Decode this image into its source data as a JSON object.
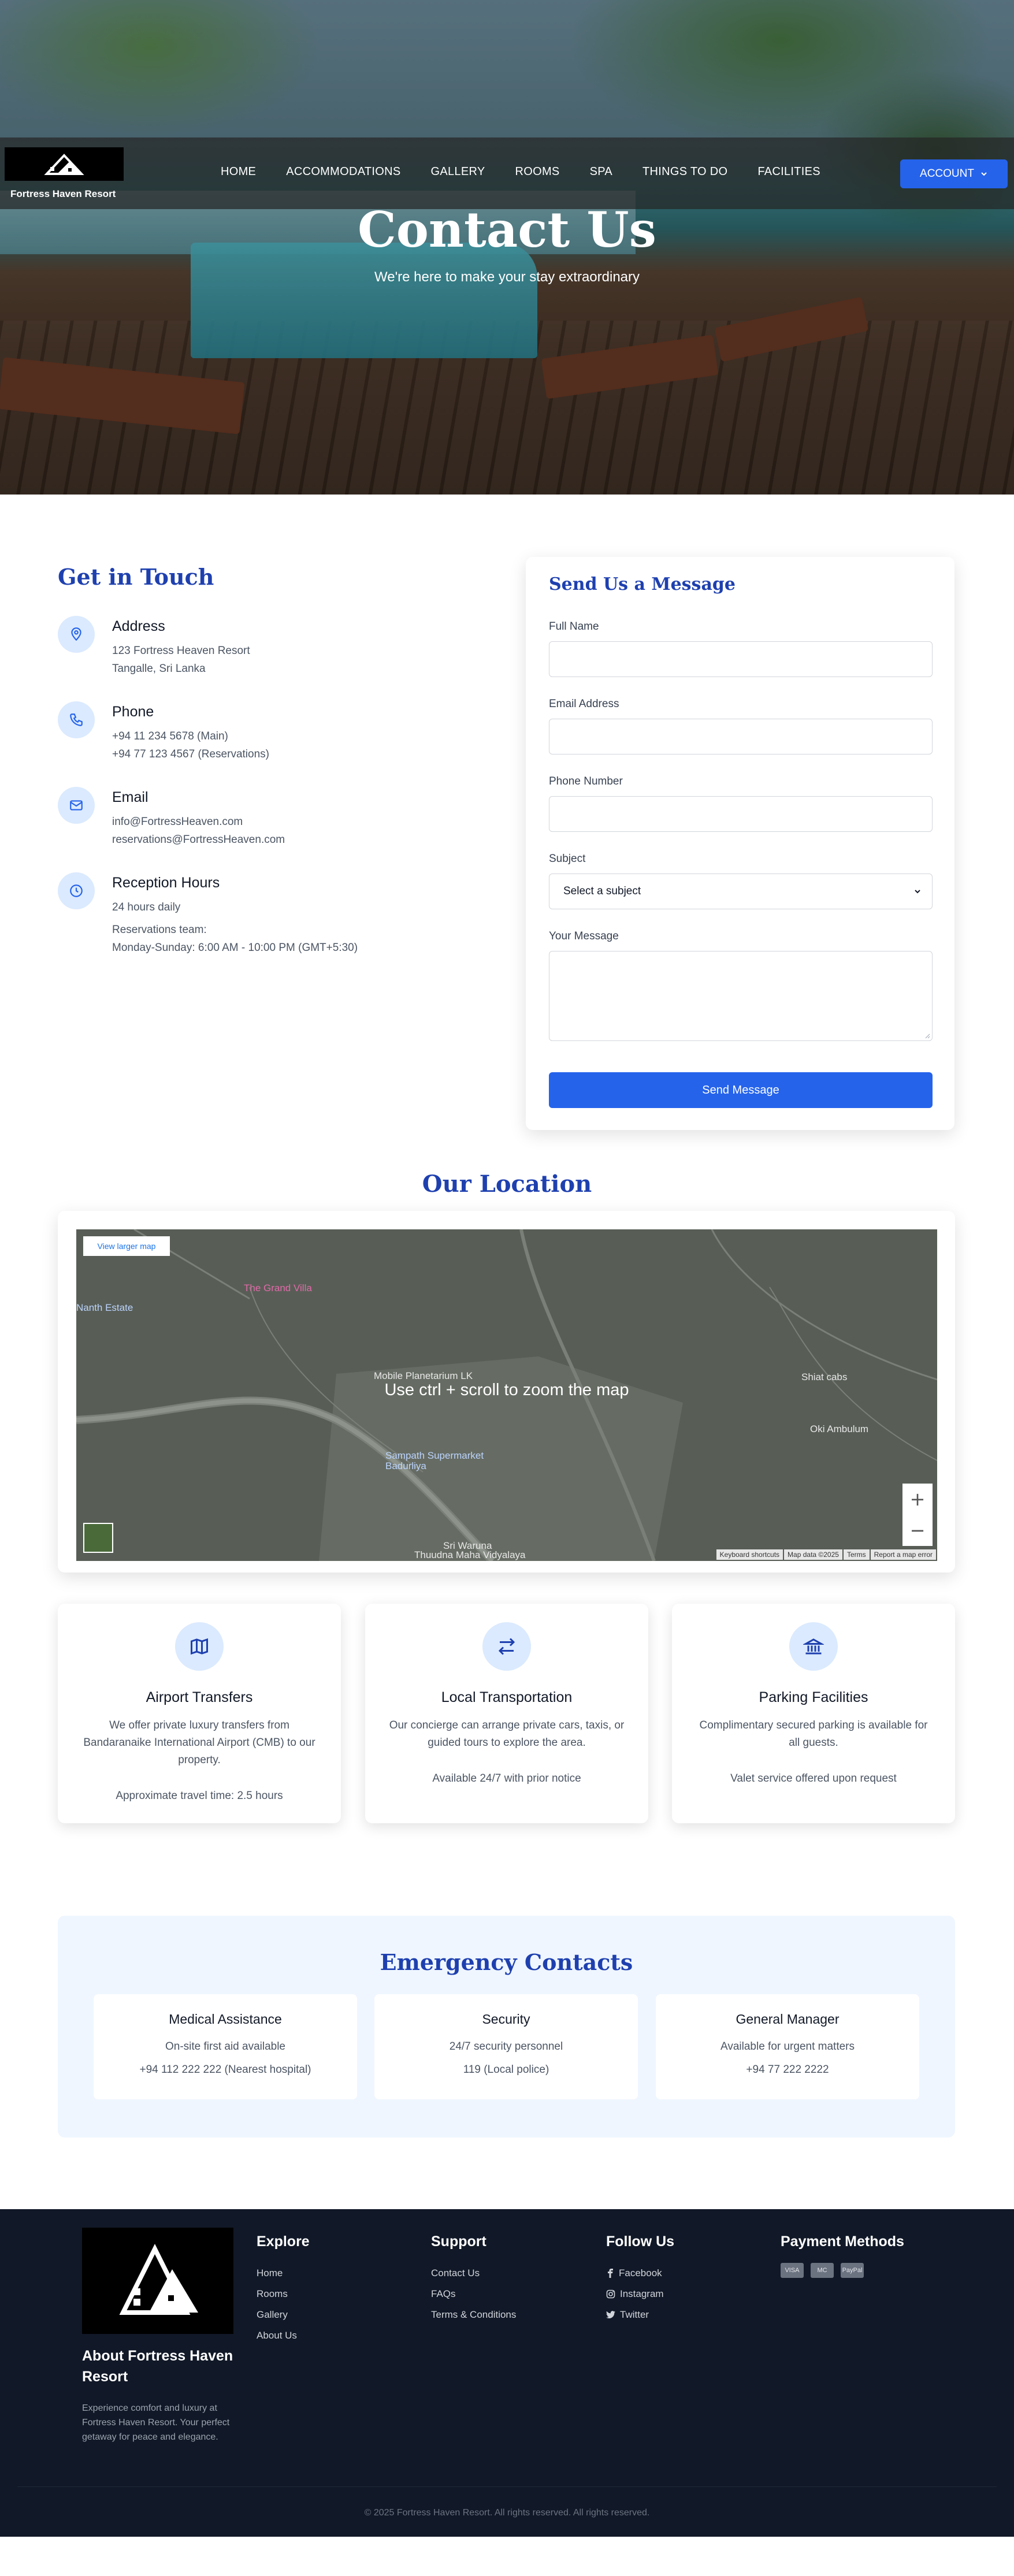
{
  "brand": {
    "name": "Fortress Haven Resort"
  },
  "nav": {
    "items": [
      "HOME",
      "ACCOMMODATIONS",
      "GALLERY",
      "ROOMS",
      "SPA",
      "THINGS TO DO",
      "FACILITIES"
    ],
    "account_label": "ACCOUNT"
  },
  "hero": {
    "title": "Contact Us",
    "subtitle": "We're here to make your stay extraordinary"
  },
  "contact": {
    "title": "Get in Touch",
    "address": {
      "label": "Address",
      "lines": [
        "123 Fortress Heaven Resort",
        "Tangalle, Sri Lanka"
      ]
    },
    "phone": {
      "label": "Phone",
      "lines": [
        "+94 11 234 5678 (Main)",
        "+94 77 123 4567 (Reservations)"
      ]
    },
    "email": {
      "label": "Email",
      "lines": [
        "info@FortressHeaven.com",
        "reservations@FortressHeaven.com"
      ]
    },
    "hours": {
      "label": "Reception Hours",
      "lines": [
        "24 hours daily",
        "Reservations team:",
        "Monday-Sunday: 6:00 AM - 10:00 PM (GMT+5:30)"
      ]
    }
  },
  "form": {
    "title": "Send Us a Message",
    "full_name_label": "Full Name",
    "email_label": "Email Address",
    "phone_label": "Phone Number",
    "subject_label": "Subject",
    "subject_value": "Select a subject",
    "message_label": "Your Message",
    "submit_label": "Send Message"
  },
  "location": {
    "title": "Our Location",
    "view_larger": "View larger map",
    "hint": "Use ctrl + scroll to zoom the map",
    "places": [
      "The Grand Villa",
      "Mobile Planetarium LK",
      "Sampath Supermarket Badurliya",
      "Shiat cabs",
      "Oki Ambulum",
      "Sri Waruna",
      "Thuudna Maha Vidyalaya",
      "Nanth Estate"
    ],
    "footer": [
      "Keyboard shortcuts",
      "Map data ©2025",
      "Terms",
      "Report a map error"
    ]
  },
  "services": [
    {
      "title": "Airport Transfers",
      "desc": "We offer private luxury transfers from Bandaranaike International Airport (CMB) to our property.",
      "note": "Approximate travel time: 2.5 hours",
      "icon": "map-icon"
    },
    {
      "title": "Local Transportation",
      "desc": "Our concierge can arrange private cars, taxis, or guided tours to explore the area.",
      "note": "Available 24/7 with prior notice",
      "icon": "exchange-icon"
    },
    {
      "title": "Parking Facilities",
      "desc": "Complimentary secured parking is available for all guests.",
      "note": "Valet service offered upon request",
      "icon": "building-icon"
    }
  ],
  "emergency": {
    "title": "Emergency Contacts",
    "cards": [
      {
        "name": "Medical Assistance",
        "line1": "On-site first aid available",
        "line2": "+94 112 222 222 (Nearest hospital)"
      },
      {
        "name": "Security",
        "line1": "24/7 security personnel",
        "line2": "119 (Local police)"
      },
      {
        "name": "General Manager",
        "line1": "Available for urgent matters",
        "line2": "+94 77 222 2222"
      }
    ]
  },
  "footer": {
    "about_title": "About Fortress Haven Resort",
    "about_text": "Experience comfort and luxury at Fortress Haven Resort. Your perfect getaway for peace and elegance.",
    "explore_title": "Explore",
    "explore": [
      "Home",
      "Rooms",
      "Gallery",
      "About Us"
    ],
    "support_title": "Support",
    "support": [
      "Contact Us",
      "FAQs",
      "Terms & Conditions"
    ],
    "follow_title": "Follow Us",
    "follow": [
      "Facebook",
      "Instagram",
      "Twitter"
    ],
    "payment_title": "Payment Methods",
    "payments": [
      "VISA",
      "MC",
      "PayPal"
    ],
    "copyright": "© 2025 Fortress Haven Resort. All rights reserved. All rights reserved."
  },
  "colors": {
    "accent": "#2563eb",
    "heading": "#1e40af",
    "footer_bg": "#111827",
    "icon_bg": "#dbeafe"
  }
}
